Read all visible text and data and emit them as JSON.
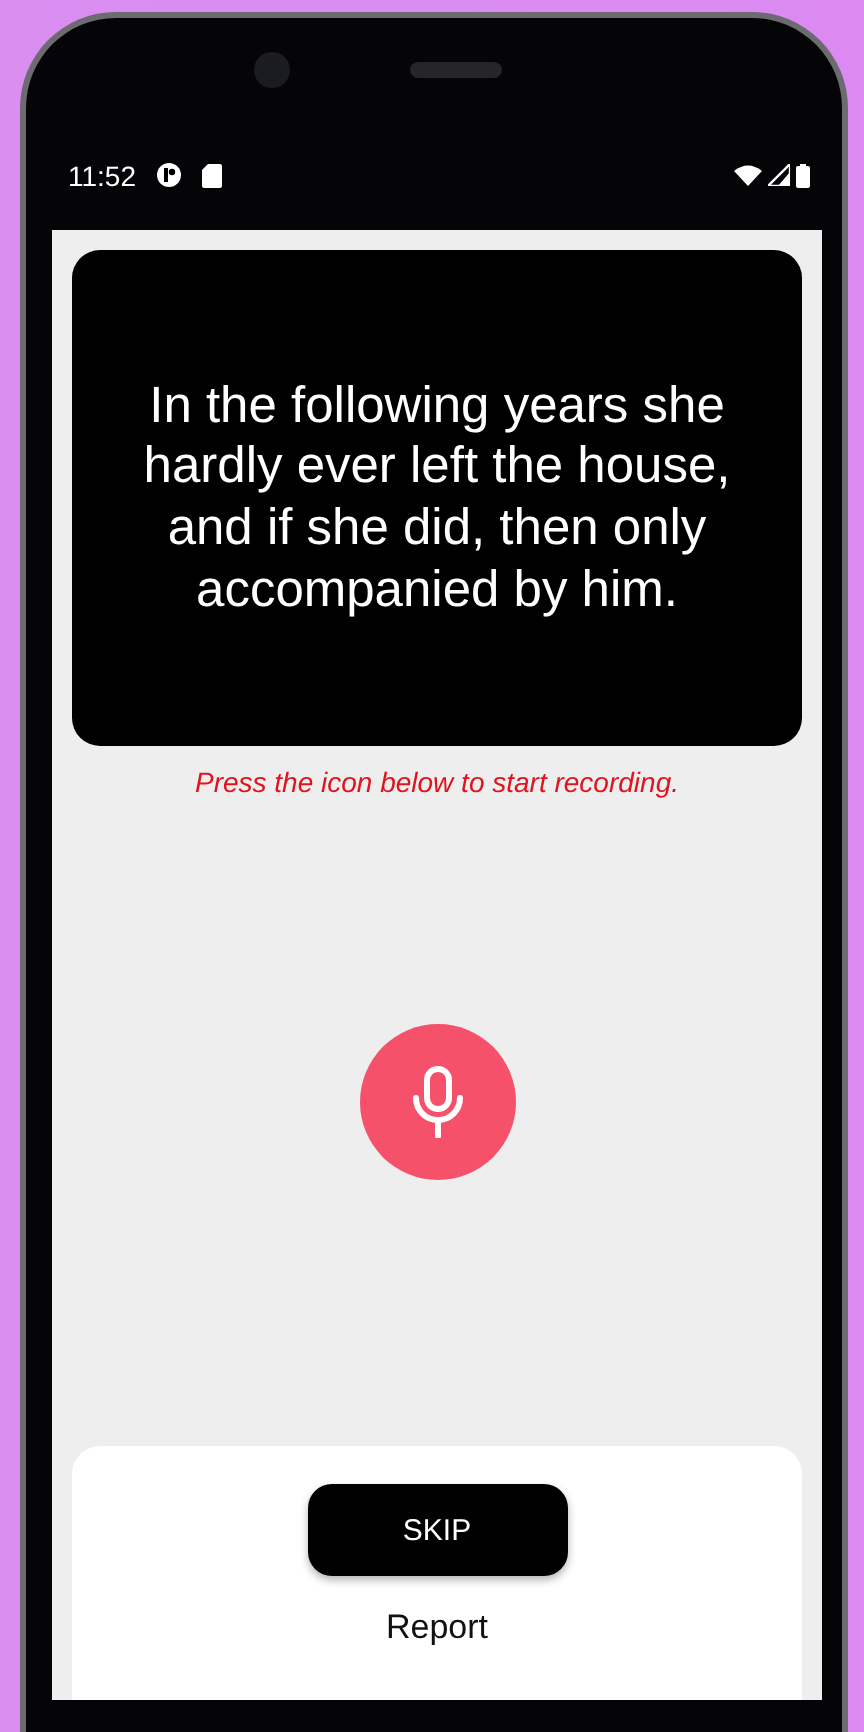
{
  "status_bar": {
    "time": "11:52"
  },
  "prompt_card": {
    "sentence": "In the following years she hardly ever left the house, and if she did, then only accompanied by him."
  },
  "hint": "Press the icon below to start recording.",
  "record_button": {
    "recording": false
  },
  "bottom_sheet": {
    "skip_label": "SKIP",
    "report_label": "Report"
  }
}
